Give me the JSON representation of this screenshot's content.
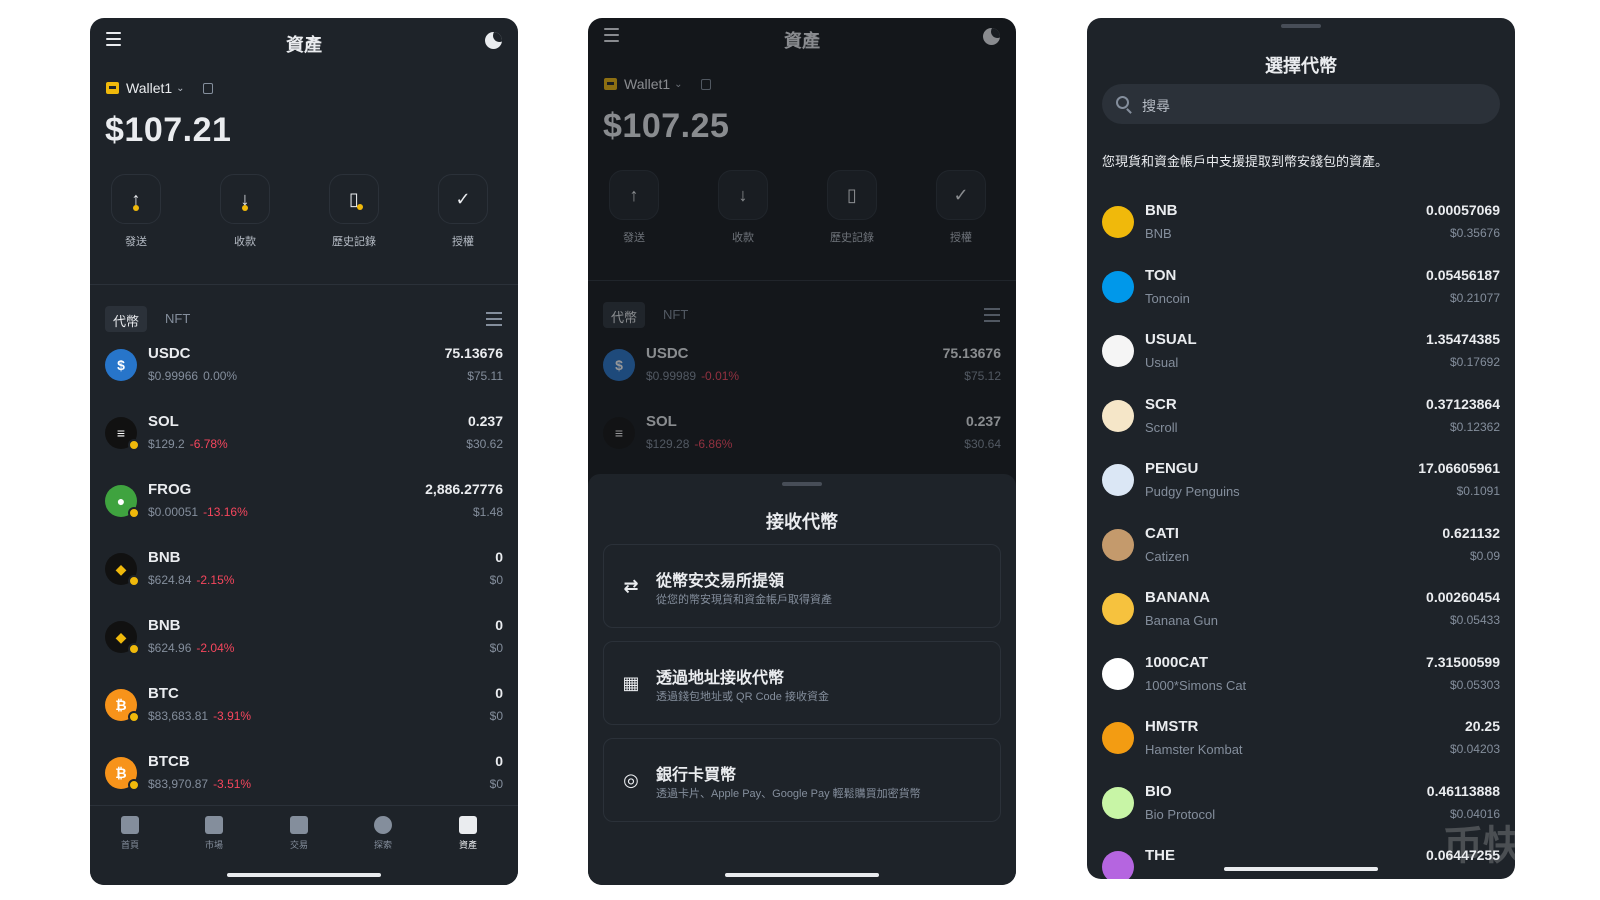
{
  "screen1": {
    "title": "資產",
    "wallet_name": "Wallet1",
    "balance": "$107.21",
    "actions": [
      {
        "label": "發送",
        "icon": "send-icon"
      },
      {
        "label": "收款",
        "icon": "receive-icon"
      },
      {
        "label": "歷史記錄",
        "icon": "history-icon"
      },
      {
        "label": "授權",
        "icon": "authorize-icon"
      }
    ],
    "tabs": [
      "代幣",
      "NFT"
    ],
    "assets": [
      {
        "symbol": "USDC",
        "price": "$0.99966",
        "change": "0.00%",
        "amount": "75.13676",
        "value": "$75.11",
        "color": "#2775ca",
        "glyph": "$"
      },
      {
        "symbol": "SOL",
        "price": "$129.2",
        "change": "-6.78%",
        "amount": "0.237",
        "value": "$30.62",
        "color": "#111111",
        "glyph": "≡"
      },
      {
        "symbol": "FROG",
        "price": "$0.00051",
        "change": "-13.16%",
        "amount": "2,886.27776",
        "value": "$1.48",
        "color": "#3fa33f",
        "glyph": "●"
      },
      {
        "symbol": "BNB",
        "price": "$624.84",
        "change": "-2.15%",
        "amount": "0",
        "value": "$0",
        "color": "#111111",
        "glyph": "◆"
      },
      {
        "symbol": "BNB",
        "price": "$624.96",
        "change": "-2.04%",
        "amount": "0",
        "value": "$0",
        "color": "#111111",
        "glyph": "◆"
      },
      {
        "symbol": "BTC",
        "price": "$83,683.81",
        "change": "-3.91%",
        "amount": "0",
        "value": "$0",
        "color": "#f7931a",
        "glyph": "₿"
      },
      {
        "symbol": "BTCB",
        "price": "$83,970.87",
        "change": "-3.51%",
        "amount": "0",
        "value": "$0",
        "color": "#f7931a",
        "glyph": "₿"
      }
    ],
    "nav": [
      {
        "label": "首頁",
        "icon": "home-icon"
      },
      {
        "label": "市場",
        "icon": "market-icon"
      },
      {
        "label": "交易",
        "icon": "trade-icon"
      },
      {
        "label": "探索",
        "icon": "explore-icon"
      },
      {
        "label": "資產",
        "icon": "assets-icon"
      }
    ]
  },
  "screen2": {
    "title": "資產",
    "wallet_name": "Wallet1",
    "balance": "$107.25",
    "actions": [
      {
        "label": "發送"
      },
      {
        "label": "收款"
      },
      {
        "label": "歷史記錄"
      },
      {
        "label": "授權"
      }
    ],
    "tabs": [
      "代幣",
      "NFT"
    ],
    "assets": [
      {
        "symbol": "USDC",
        "price": "$0.99989",
        "change": "-0.01%",
        "amount": "75.13676",
        "value": "$75.12"
      },
      {
        "symbol": "SOL",
        "price": "$129.28",
        "change": "-6.86%",
        "amount": "0.237",
        "value": "$30.64"
      }
    ],
    "sheet": {
      "title": "接收代幣",
      "options": [
        {
          "title": "從幣安交易所提領",
          "desc": "從您的幣安現貨和資金帳戶取得資產",
          "icon": "transfer-icon"
        },
        {
          "title": "透過地址接收代幣",
          "desc": "透過錢包地址或 QR Code 接收資金",
          "icon": "qr-code-icon"
        },
        {
          "title": "銀行卡買幣",
          "desc": "透過卡片、Apple Pay、Google Pay 輕鬆購買加密貨幣",
          "icon": "card-icon"
        }
      ]
    }
  },
  "screen3": {
    "title": "選擇代幣",
    "search_placeholder": "搜尋",
    "note": "您現貨和資金帳戶中支援提取到幣安錢包的資產。",
    "tokens": [
      {
        "symbol": "BNB",
        "name": "BNB",
        "amount": "0.00057069",
        "value": "$0.35676",
        "color": "#f0b90b"
      },
      {
        "symbol": "TON",
        "name": "Toncoin",
        "amount": "0.05456187",
        "value": "$0.21077",
        "color": "#0098ea"
      },
      {
        "symbol": "USUAL",
        "name": "Usual",
        "amount": "1.35474385",
        "value": "$0.17692",
        "color": "#f5f5f5"
      },
      {
        "symbol": "SCR",
        "name": "Scroll",
        "amount": "0.37123864",
        "value": "$0.12362",
        "color": "#f5e6c8"
      },
      {
        "symbol": "PENGU",
        "name": "Pudgy Penguins",
        "amount": "17.06605961",
        "value": "$0.1091",
        "color": "#dbe7f5"
      },
      {
        "symbol": "CATI",
        "name": "Catizen",
        "amount": "0.621132",
        "value": "$0.09",
        "color": "#c49a6c"
      },
      {
        "symbol": "BANANA",
        "name": "Banana Gun",
        "amount": "0.00260454",
        "value": "$0.05433",
        "color": "#f6c23e"
      },
      {
        "symbol": "1000CAT",
        "name": "1000*Simons Cat",
        "amount": "7.31500599",
        "value": "$0.05303",
        "color": "#ffffff"
      },
      {
        "symbol": "HMSTR",
        "name": "Hamster Kombat",
        "amount": "20.25",
        "value": "$0.04203",
        "color": "#f39c12"
      },
      {
        "symbol": "BIO",
        "name": "Bio Protocol",
        "amount": "0.46113888",
        "value": "$0.04016",
        "color": "#c8f5a6"
      },
      {
        "symbol": "THE",
        "name": "",
        "amount": "0.06447255",
        "value": "",
        "color": "#b565e0"
      }
    ],
    "watermark": "币快"
  }
}
